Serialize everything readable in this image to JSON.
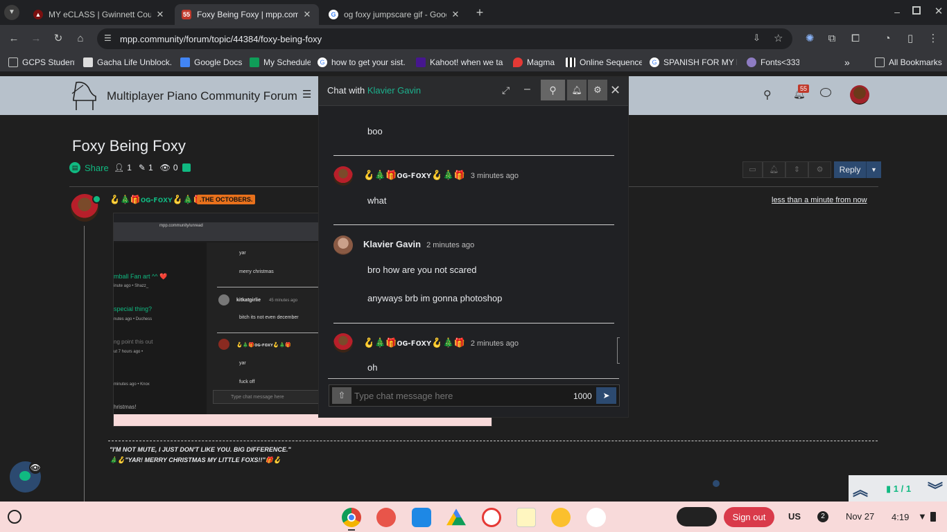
{
  "browser": {
    "tabs": [
      {
        "title": "MY eCLASS | Gwinnett County P",
        "active": false
      },
      {
        "title": "Foxy Being Foxy | mpp.commu",
        "active": true
      },
      {
        "title": "og foxy jumpscare gif - Google",
        "active": false
      }
    ],
    "url": "mpp.community/forum/topic/44384/foxy-being-foxy",
    "bookmarks": [
      "GCPS Student",
      "Gacha Life Unblock...",
      "Google Docs",
      "My Schedule",
      "how to get your sist...",
      "Kahoot! when we ta...",
      "Magma",
      "Online Sequencer",
      "SPANISH FOR MY P...",
      "Fonts<333"
    ],
    "all_bookmarks": "All Bookmarks"
  },
  "forum": {
    "name": "Multiplayer Piano Community Forum",
    "notification_count": "55",
    "topic_title": "Foxy Being Foxy",
    "share_label": "Share",
    "stats": {
      "posters": "1",
      "posts": "1",
      "views": "0"
    },
    "reply_label": "Reply",
    "post": {
      "author": "🪝🎄🎁ᴏɢ-ꜰᴏxʏ🪝🎄🎁",
      "group_badge": ".THE OCTOBERS.",
      "timestamp": "less than a minute from now",
      "signature_line1": "\"I'M NOT MUTE, I JUST DON'T LIKE YOU. BIG DIFFERENCE.\"",
      "signature_line2": "🎄🪝\"YAR! MERRY CHRISTMAS MY LITTLE FOXS!!\"🎁🪝"
    },
    "pagination": "1 / 1"
  },
  "embedded_screenshot": {
    "url": "mpp.community/unread",
    "items": [
      "mball Fan art ^^ ❤️",
      "inute ago • Shazz_",
      "special thing?",
      "nutes ago • Duchess",
      "ng point this out",
      "ut 7 hours ago •",
      "minutes ago • Knox",
      "hristmas!"
    ],
    "messages": [
      "yar",
      "merry christmas",
      "kitkatgirlie",
      "45 minutes ago",
      "bitch its not even december",
      "🪝🎄🎁ᴏɢ-ꜰᴏxʏ🪝🎄🎁",
      "yar",
      "fuck off"
    ],
    "placeholder": "Type chat message here"
  },
  "chat": {
    "title_prefix": "Chat with",
    "partner": "Klavier Gavin",
    "messages": [
      {
        "text": "boo"
      },
      {
        "author": "🪝🎄🎁ᴏɢ-ꜰᴏxʏ🪝🎄🎁",
        "time": "3 minutes ago",
        "text": "what"
      },
      {
        "author": "Klavier Gavin",
        "time": "2 minutes ago",
        "text": "bro how are you not scared",
        "text2": "anyways brb im gonna photoshop"
      },
      {
        "author": "🪝🎄🎁ᴏɢ-ꜰᴏxʏ🪝🎄🎁",
        "time": "2 minutes ago",
        "text": "oh"
      }
    ],
    "input_placeholder": "Type chat message here",
    "char_count": "1000"
  },
  "shelf": {
    "sign_out": "Sign out",
    "ime": "US",
    "notif_count": "2",
    "date": "Nov 27",
    "time": "4:19"
  },
  "colors": {
    "forum_accent": "#10b981",
    "chat_partner": "#1cb28e",
    "reply_button": "#2c4a70",
    "badge": "#e8711c",
    "signout": "#d93a4a",
    "shelf_bg": "#f8dada"
  }
}
